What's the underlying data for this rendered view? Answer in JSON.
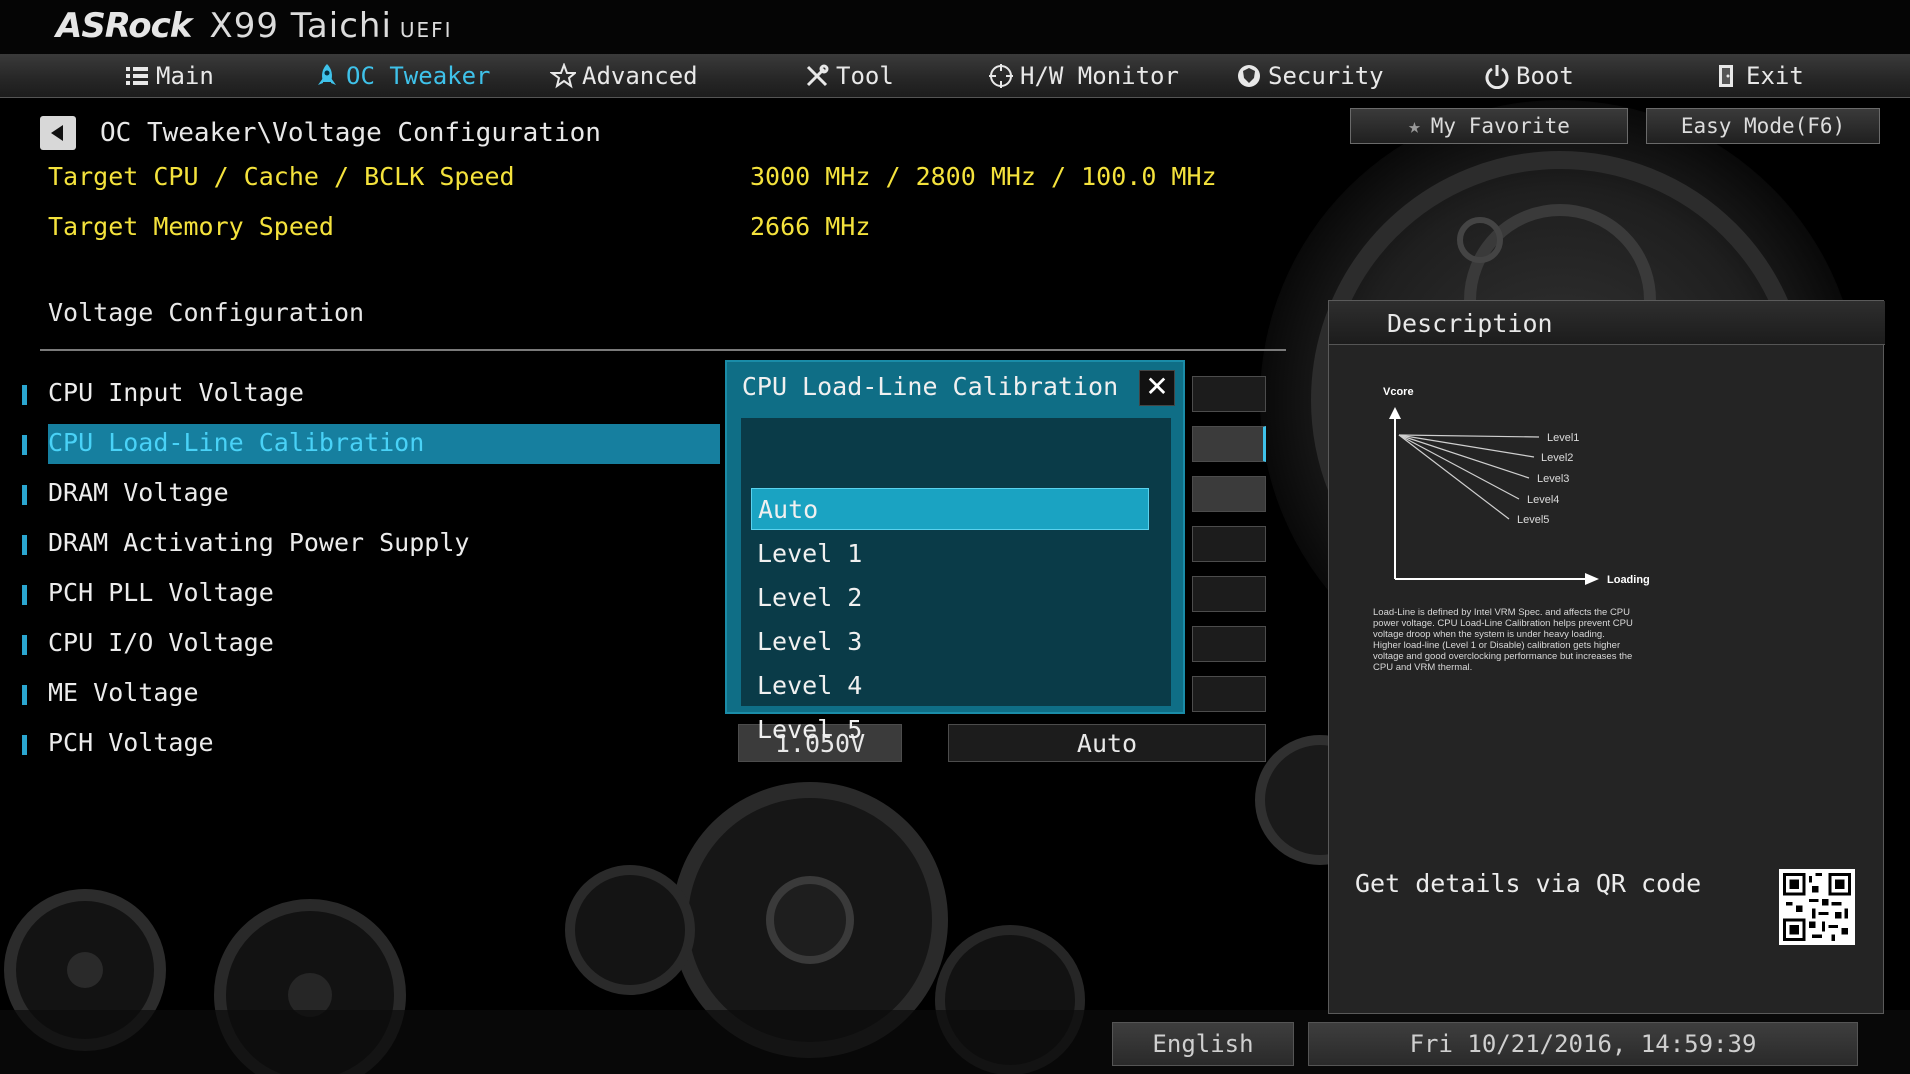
{
  "brand": {
    "logo": "ASRock",
    "model": "X99 Taichi",
    "suffix": "UEFI"
  },
  "nav": {
    "items": [
      {
        "label": "Main",
        "icon": "list-icon",
        "active": false
      },
      {
        "label": "OC Tweaker",
        "icon": "rocket-icon",
        "active": true
      },
      {
        "label": "Advanced",
        "icon": "star-icon",
        "active": false
      },
      {
        "label": "Tool",
        "icon": "tools-icon",
        "active": false
      },
      {
        "label": "H/W Monitor",
        "icon": "crosshair-icon",
        "active": false
      },
      {
        "label": "Security",
        "icon": "shield-icon",
        "active": false
      },
      {
        "label": "Boot",
        "icon": "power-icon",
        "active": false
      },
      {
        "label": "Exit",
        "icon": "exit-door-icon",
        "active": false
      }
    ]
  },
  "header": {
    "breadcrumb": "OC Tweaker\\Voltage Configuration"
  },
  "info": [
    {
      "label": "Target CPU / Cache / BCLK Speed",
      "value": "3000 MHz / 2800 MHz / 100.0 MHz"
    },
    {
      "label": "Target Memory Speed",
      "value": "2666 MHz"
    }
  ],
  "section_title": "Voltage Configuration",
  "settings": [
    {
      "label": "CPU Input Voltage"
    },
    {
      "label": "CPU Load-Line Calibration"
    },
    {
      "label": "DRAM Voltage"
    },
    {
      "label": "DRAM Activating Power Supply"
    },
    {
      "label": "PCH PLL Voltage"
    },
    {
      "label": "CPU I/O Voltage"
    },
    {
      "label": "ME Voltage"
    },
    {
      "label": "PCH Voltage"
    }
  ],
  "pch_voltage": {
    "current": "1.050V",
    "mode": "Auto"
  },
  "selected_setting": "CPU Load-Line Calibration",
  "modal": {
    "title": "CPU Load-Line Calibration",
    "close_label": "✕",
    "options": [
      "Auto",
      "Level 1",
      "Level 2",
      "Level 3",
      "Level 4",
      "Level 5"
    ],
    "selected": "Auto"
  },
  "side": {
    "favorite_label": "My Favorite",
    "easy_mode_label": "Easy Mode(F6)"
  },
  "description": {
    "title": "Description",
    "diagram": {
      "y_label": "Vcore",
      "x_label": "Loading",
      "lines": [
        "Level1",
        "Level2",
        "Level3",
        "Level4",
        "Level5"
      ]
    },
    "text": "Load-Line is defined by Intel VRM Spec. and affects the CPU power voltage. CPU Load-Line Calibration helps prevent CPU voltage droop when the system is under heavy loading. Higher load-line (Level 1 or Disable) calibration gets higher voltage and good overclocking performance but increases the CPU and VRM thermal.",
    "qr_label": "Get details via QR code"
  },
  "footer": {
    "language": "English",
    "datetime": "Fri 10/21/2016, 14:59:39"
  },
  "colors": {
    "accent": "#3fc2ea",
    "highlight": "#167f9f",
    "info_text": "#f4e23c",
    "modal_bg": "#0f6e86"
  }
}
